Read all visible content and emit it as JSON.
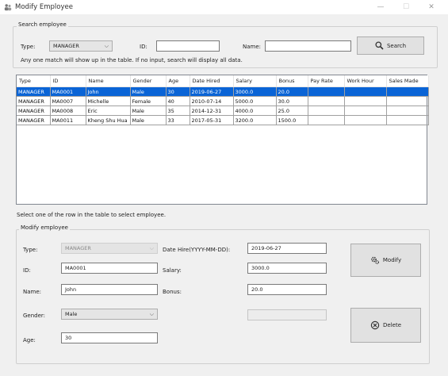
{
  "window": {
    "title": "Modify Employee",
    "minimize": "—",
    "maximize": "☐",
    "close": "✕"
  },
  "search": {
    "group_label": "Search employee",
    "type_label": "Type:",
    "type_value": "MANAGER",
    "id_label": "ID:",
    "id_value": "",
    "name_label": "Name:",
    "name_value": "",
    "button_label": "Search",
    "hint": "Any one match will show up in the table. If no input, search will display all data."
  },
  "table": {
    "columns": [
      "Type",
      "ID",
      "Name",
      "Gender",
      "Age",
      "Date Hired",
      "Salary",
      "Bonus",
      "Pay Rate",
      "Work Hour",
      "Sales Made"
    ],
    "rows": [
      [
        "MANAGER",
        "MA0001",
        "John",
        "Male",
        "30",
        "2019-06-27",
        "3000.0",
        "20.0",
        "",
        "",
        ""
      ],
      [
        "MANAGER",
        "MA0007",
        "Michelle",
        "Female",
        "40",
        "2010-07-14",
        "5000.0",
        "30.0",
        "",
        "",
        ""
      ],
      [
        "MANAGER",
        "MA0008",
        "Eric",
        "Male",
        "35",
        "2014-12-31",
        "4000.0",
        "25.0",
        "",
        "",
        ""
      ],
      [
        "MANAGER",
        "MA0011",
        "Kheng Shu Hua",
        "Male",
        "33",
        "2017-05-31",
        "3200.0",
        "1500.0",
        "",
        "",
        ""
      ]
    ],
    "selected_row": 0
  },
  "select_hint": "Select one of the row in the table to select employee.",
  "modify": {
    "group_label": "Modify employee",
    "type_label": "Type:",
    "type_value": "MANAGER",
    "id_label": "ID:",
    "id_value": "MA0001",
    "name_label": "Name:",
    "name_value": "John",
    "gender_label": "Gender:",
    "gender_value": "Male",
    "age_label": "Age:",
    "age_value": "30",
    "date_label": "Date Hire(YYYY-MM-DD):",
    "date_value": "2019-06-27",
    "salary_label": "Salary:",
    "salary_value": "3000.0",
    "bonus_label": "Bonus:",
    "bonus_value": "20.0",
    "extra_value": "",
    "modify_button": "Modify",
    "delete_button": "Delete"
  },
  "icons": {
    "app": "people-icon",
    "search": "magnifier-icon",
    "modify": "gears-icon",
    "delete": "circle-x-icon"
  },
  "colors": {
    "selection": "#0a64d6",
    "window_bg": "#f0f0f0"
  }
}
